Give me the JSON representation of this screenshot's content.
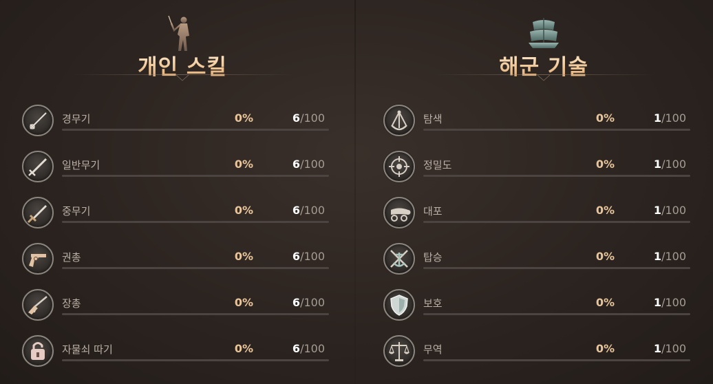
{
  "personal": {
    "title": "개인 스킬",
    "header_icon": "swordsman-silhouette-icon",
    "skills": [
      {
        "name": "경무기",
        "icon": "rapier-icon",
        "percent": "0%",
        "level": "6",
        "max": "/100",
        "progress": 0
      },
      {
        "name": "일반무기",
        "icon": "sword-icon",
        "percent": "0%",
        "level": "6",
        "max": "/100",
        "progress": 0
      },
      {
        "name": "중무기",
        "icon": "broadsword-icon",
        "percent": "0%",
        "level": "6",
        "max": "/100",
        "progress": 0
      },
      {
        "name": "권총",
        "icon": "pistol-icon",
        "percent": "0%",
        "level": "6",
        "max": "/100",
        "progress": 0
      },
      {
        "name": "장총",
        "icon": "musket-icon",
        "percent": "0%",
        "level": "6",
        "max": "/100",
        "progress": 0
      },
      {
        "name": "자물쇠 따기",
        "icon": "lockpick-icon",
        "percent": "0%",
        "level": "6",
        "max": "/100",
        "progress": 0
      }
    ]
  },
  "naval": {
    "title": "해군 기술",
    "header_icon": "ship-sails-icon",
    "skills": [
      {
        "name": "탐색",
        "icon": "sextant-icon",
        "percent": "0%",
        "level": "1",
        "max": "/100",
        "progress": 0
      },
      {
        "name": "정밀도",
        "icon": "crosshair-icon",
        "percent": "0%",
        "level": "1",
        "max": "/100",
        "progress": 0
      },
      {
        "name": "대포",
        "icon": "cannon-icon",
        "percent": "0%",
        "level": "1",
        "max": "/100",
        "progress": 0
      },
      {
        "name": "탑승",
        "icon": "boarding-anchor-swords-icon",
        "percent": "0%",
        "level": "1",
        "max": "/100",
        "progress": 0
      },
      {
        "name": "보호",
        "icon": "shield-icon",
        "percent": "0%",
        "level": "1",
        "max": "/100",
        "progress": 0
      },
      {
        "name": "무역",
        "icon": "scales-icon",
        "percent": "0%",
        "level": "1",
        "max": "/100",
        "progress": 0
      }
    ]
  },
  "colors": {
    "accent": "#e8c59b",
    "bar_track": "#4b4440",
    "background": "#2c2420"
  }
}
